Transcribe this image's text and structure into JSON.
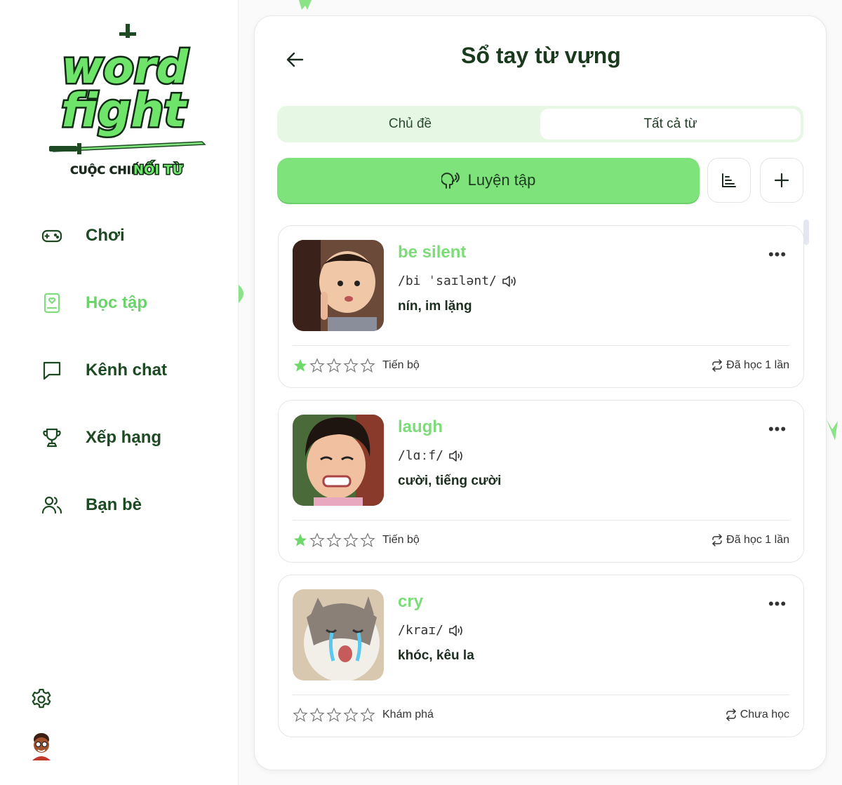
{
  "brand": {
    "logo_line1": "word",
    "logo_line2": "fight",
    "tagline_part1": "CUỘC CHIẾN",
    "tagline_part2": "NỐI TỪ"
  },
  "sidebar": {
    "items": [
      {
        "label": "Chơi",
        "icon": "gamepad-icon",
        "active": false
      },
      {
        "label": "Học tập",
        "icon": "notebook-icon",
        "active": true
      },
      {
        "label": "Kênh chat",
        "icon": "chat-bubble-icon",
        "active": false
      },
      {
        "label": "Xếp hạng",
        "icon": "trophy-icon",
        "active": false
      },
      {
        "label": "Bạn bè",
        "icon": "friends-icon",
        "active": false
      }
    ],
    "settings_icon": "gear-icon",
    "avatar_icon": "user-avatar"
  },
  "header": {
    "title": "Sổ tay từ vựng",
    "back_icon": "arrow-left-icon"
  },
  "tabs": [
    {
      "label": "Chủ đề",
      "selected": false
    },
    {
      "label": "Tất cả từ",
      "selected": true
    }
  ],
  "actions": {
    "practice_label": "Luyện tập",
    "practice_icon": "speaking-head-icon",
    "sort_icon": "sort-bars-icon",
    "add_icon": "plus-icon"
  },
  "words": [
    {
      "word": "be silent",
      "ipa": "/bi ˈsaɪlənt/",
      "meaning": "nín, im lặng",
      "stars": 1,
      "max_stars": 5,
      "level": "Tiến bộ",
      "status": "Đã học 1 lần",
      "image": "toddler-shushing-photo"
    },
    {
      "word": "laugh",
      "ipa": "/lɑːf/",
      "meaning": "cười, tiếng cười",
      "stars": 1,
      "max_stars": 5,
      "level": "Tiến bộ",
      "status": "Đã học 1 lần",
      "image": "girl-grimacing-photo"
    },
    {
      "word": "cry",
      "ipa": "/kraɪ/",
      "meaning": "khóc, kêu la",
      "stars": 0,
      "max_stars": 5,
      "level": "Khám phá",
      "status": "Chưa học",
      "image": "crying-cat-photo"
    }
  ],
  "colors": {
    "accent": "#7fe37c",
    "active_text": "#6ad46a",
    "dark_green": "#1d4a23",
    "tab_bg": "#e6f8e4",
    "star_filled": "#6fd86b"
  }
}
